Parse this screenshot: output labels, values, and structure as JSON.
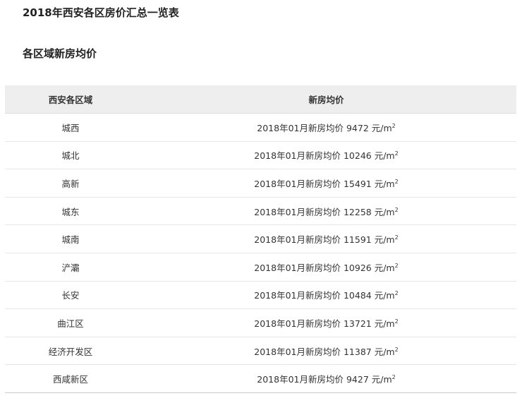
{
  "page_title": "2018年西安各区房价汇总一览表",
  "section_title": "各区域新房均价",
  "table": {
    "headers": [
      "西安各区域",
      "新房均价"
    ],
    "unit": "元/m",
    "unit_sup": "2",
    "rows": [
      {
        "district": "城西",
        "price_text": "2018年01月新房均价 9472 元/m"
      },
      {
        "district": "城北",
        "price_text": "2018年01月新房均价 10246 元/m"
      },
      {
        "district": "高新",
        "price_text": "2018年01月新房均价 15491 元/m"
      },
      {
        "district": "城东",
        "price_text": "2018年01月新房均价 12258 元/m"
      },
      {
        "district": "城南",
        "price_text": "2018年01月新房均价 11591 元/m"
      },
      {
        "district": "浐灞",
        "price_text": "2018年01月新房均价 10926 元/m"
      },
      {
        "district": "长安",
        "price_text": "2018年01月新房均价 10484 元/m"
      },
      {
        "district": "曲江区",
        "price_text": "2018年01月新房均价 13721 元/m"
      },
      {
        "district": "经济开发区",
        "price_text": "2018年01月新房均价 11387 元/m"
      },
      {
        "district": "西咸新区",
        "price_text": "2018年01月新房均价 9427 元/m"
      }
    ]
  }
}
